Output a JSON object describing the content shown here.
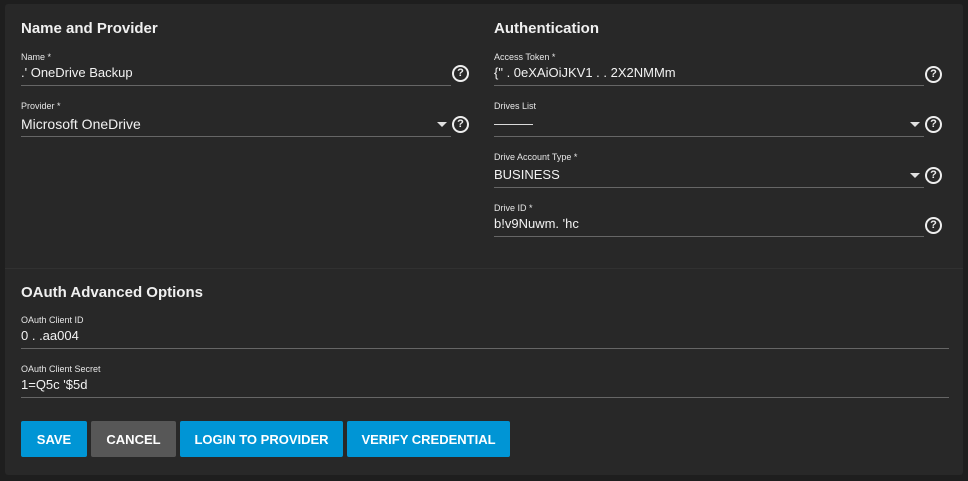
{
  "name_provider": {
    "title": "Name and Provider",
    "name": {
      "label": "Name *",
      "value": ".'     OneDrive Backup"
    },
    "provider": {
      "label": "Provider *",
      "value": "Microsoft OneDrive"
    }
  },
  "authentication": {
    "title": "Authentication",
    "access_token": {
      "label": "Access Token *",
      "value": "{\"          .          0eXAiOiJKV1              .                    .    2X2NMMm"
    },
    "drives_list": {
      "label": "Drives List",
      "value": "———"
    },
    "drive_account_type": {
      "label": "Drive Account Type *",
      "value": "BUSINESS"
    },
    "drive_id": {
      "label": "Drive ID *",
      "value": "b!v9Nuwm.                                                                     'hc"
    }
  },
  "oauth": {
    "title": "OAuth Advanced Options",
    "client_id": {
      "label": "OAuth Client ID",
      "value": "0           .                                   .aa004"
    },
    "client_secret": {
      "label": "OAuth Client Secret",
      "value": "1=Q5c                                                                  '$5d"
    }
  },
  "buttons": {
    "save": "SAVE",
    "cancel": "CANCEL",
    "login": "LOGIN TO PROVIDER",
    "verify": "VERIFY CREDENTIAL"
  },
  "colors": {
    "primary": "#0095d5",
    "cancel": "#575757",
    "card": "#282828",
    "background": "#1e1e1e"
  },
  "icons": {
    "help": "?",
    "dropdown": "caret-down"
  }
}
